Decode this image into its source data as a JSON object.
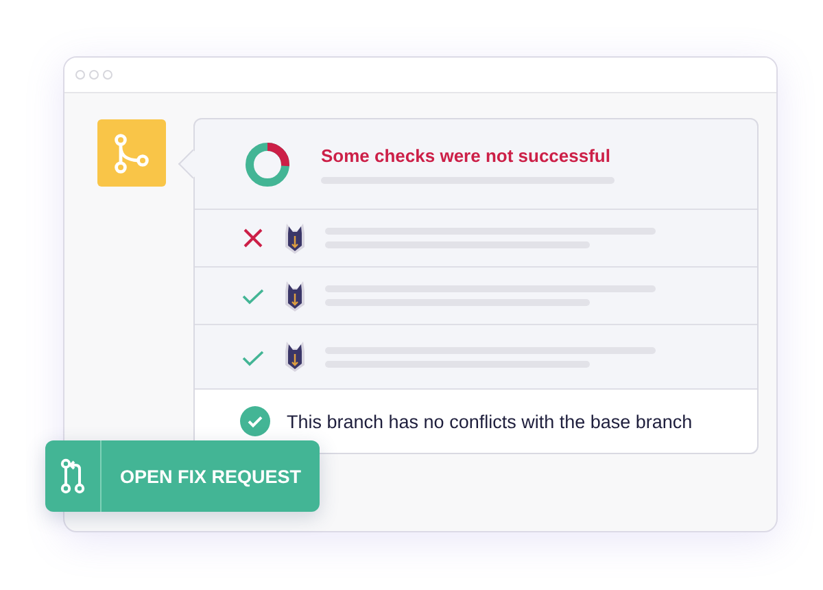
{
  "status": {
    "title": "Some checks were not successful"
  },
  "checks": [
    {
      "passed": false
    },
    {
      "passed": true
    },
    {
      "passed": true
    }
  ],
  "merge_status": "This branch has no conflicts with the base branch",
  "action_button": {
    "label": "OPEN FIX REQUEST"
  }
}
